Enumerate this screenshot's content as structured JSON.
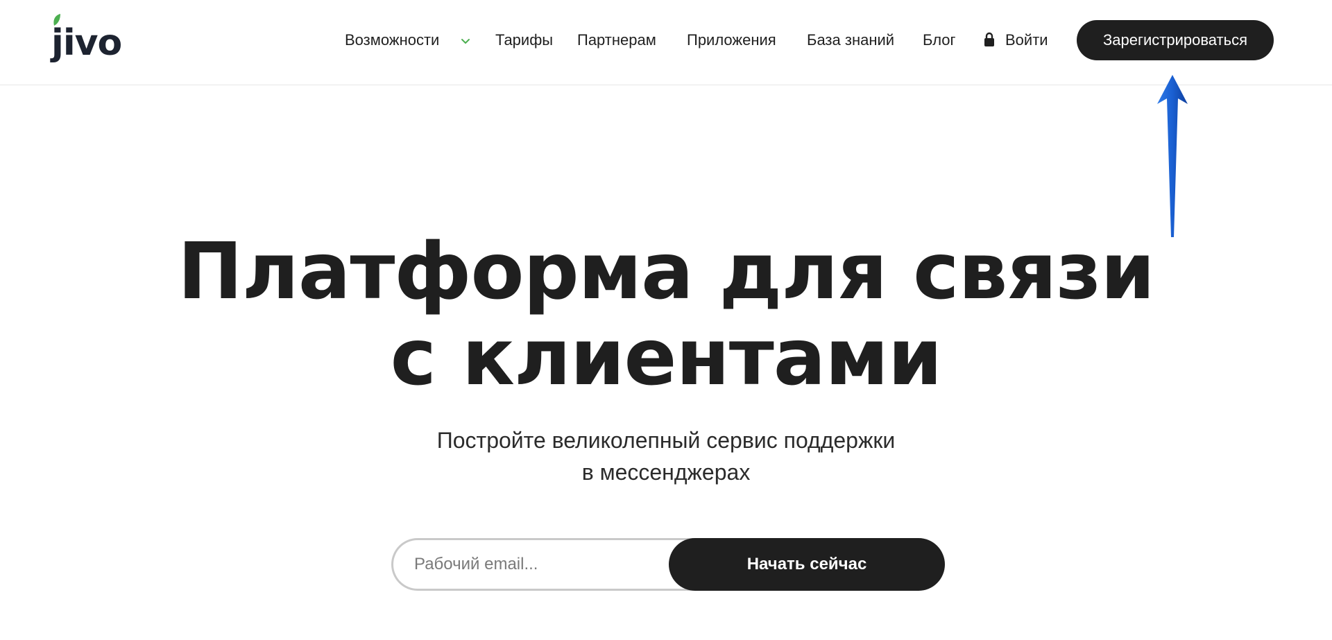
{
  "logo": {
    "text": "jivo",
    "leaf_color": "#4caf50"
  },
  "nav": {
    "items": [
      {
        "label": "Возможности",
        "has_dropdown": true
      },
      {
        "label": "Тарифы"
      },
      {
        "label": "Партнерам"
      },
      {
        "label": "Приложения"
      },
      {
        "label": "База знаний"
      },
      {
        "label": "Блог"
      }
    ],
    "login_label": "Войти",
    "signup_label": "Зарегистрироваться"
  },
  "hero": {
    "title_line1": "Платформа для связи",
    "title_line2": "с клиентами",
    "subtitle_line1": "Постройте великолепный сервис поддержки",
    "subtitle_line2": "в мессенджерах"
  },
  "form": {
    "email_placeholder": "Рабочий email...",
    "email_value": "",
    "submit_label": "Начать сейчас"
  },
  "colors": {
    "accent_dark": "#1f1f1f",
    "annotation_arrow": "#1a5fd1",
    "dropdown_chevron": "#4caf50"
  },
  "icons": [
    "leaf-icon",
    "chevron-down-icon",
    "lock-icon",
    "annotation-arrow-icon"
  ]
}
